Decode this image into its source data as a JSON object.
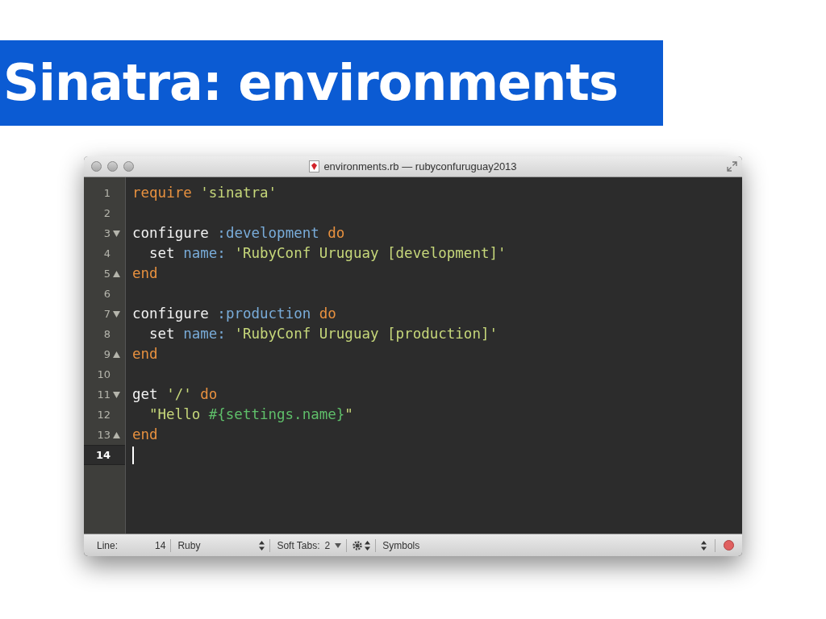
{
  "slide_title": "Sinatra: environments",
  "window": {
    "title": "environments.rb — rubyconfuruguay2013"
  },
  "editor": {
    "lines": [
      {
        "number": "1",
        "fold_start": false,
        "fold_end": false,
        "indented": false,
        "current": false,
        "tokens": [
          {
            "kind": "keyword",
            "text": "require"
          },
          {
            "kind": "string",
            "text": " 'sinatra'"
          }
        ]
      },
      {
        "number": "2",
        "fold_start": false,
        "fold_end": false,
        "current": false
      },
      {
        "number": "3",
        "fold_start": true,
        "fold_end": false,
        "indented": false,
        "current": false,
        "tokens": [
          {
            "kind": "plain",
            "text": "configure "
          },
          {
            "kind": "symbol",
            "text": ":development"
          },
          {
            "kind": "keyword",
            "text": " do"
          }
        ]
      },
      {
        "number": "4",
        "fold_start": false,
        "fold_end": false,
        "indented": true,
        "current": false,
        "tokens": [
          {
            "kind": "plain",
            "text": "set "
          },
          {
            "kind": "symbol",
            "text": "name:"
          },
          {
            "kind": "string",
            "text": " 'RubyConf Uruguay [development]'"
          }
        ]
      },
      {
        "number": "5",
        "fold_start": false,
        "fold_end": true,
        "indented": false,
        "current": false,
        "tokens": [
          {
            "kind": "keyword",
            "text": "end"
          }
        ]
      },
      {
        "number": "6",
        "fold_start": false,
        "fold_end": false,
        "current": false
      },
      {
        "number": "7",
        "fold_start": true,
        "fold_end": false,
        "indented": false,
        "current": false,
        "tokens": [
          {
            "kind": "plain",
            "text": "configure "
          },
          {
            "kind": "symbol",
            "text": ":production"
          },
          {
            "kind": "keyword",
            "text": " do"
          }
        ]
      },
      {
        "number": "8",
        "fold_start": false,
        "fold_end": false,
        "indented": true,
        "current": false,
        "tokens": [
          {
            "kind": "plain",
            "text": "set "
          },
          {
            "kind": "symbol",
            "text": "name:"
          },
          {
            "kind": "string",
            "text": " 'RubyConf Uruguay [production]'"
          }
        ]
      },
      {
        "number": "9",
        "fold_start": false,
        "fold_end": true,
        "indented": false,
        "current": false,
        "tokens": [
          {
            "kind": "keyword",
            "text": "end"
          }
        ]
      },
      {
        "number": "10",
        "fold_start": false,
        "fold_end": false,
        "current": false
      },
      {
        "number": "11",
        "fold_start": true,
        "fold_end": false,
        "indented": false,
        "current": false,
        "tokens": [
          {
            "kind": "plain",
            "text": "get "
          },
          {
            "kind": "string",
            "text": "'/'"
          },
          {
            "kind": "keyword",
            "text": " do"
          }
        ]
      },
      {
        "number": "12",
        "fold_start": false,
        "fold_end": false,
        "indented": true,
        "current": false,
        "tokens": [
          {
            "kind": "string",
            "text": "\"Hello "
          },
          {
            "kind": "interp",
            "text": "#{settings.name}"
          },
          {
            "kind": "string",
            "text": "\""
          }
        ]
      },
      {
        "number": "13",
        "fold_start": false,
        "fold_end": true,
        "indented": false,
        "current": false,
        "tokens": [
          {
            "kind": "keyword",
            "text": "end"
          }
        ]
      },
      {
        "number": "14",
        "fold_start": false,
        "fold_end": false,
        "current": true
      }
    ]
  },
  "status_bar": {
    "line_label": "Line:",
    "line_value": "14",
    "language": "Ruby",
    "tabs_label": "Soft Tabs:",
    "tabs_value": "2",
    "symbols": "Symbols"
  }
}
